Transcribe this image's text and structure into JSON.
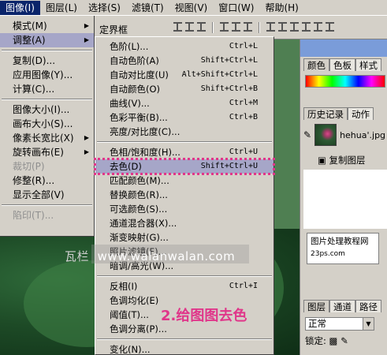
{
  "menubar": {
    "items": [
      "图像(I)",
      "图层(L)",
      "选择(S)",
      "滤镜(T)",
      "视图(V)",
      "窗口(W)",
      "帮助(H)"
    ],
    "active_index": 0
  },
  "options_bar": {
    "label": "定界框"
  },
  "image_menu": {
    "items": [
      {
        "label": "模式(M)",
        "submenu": true
      },
      {
        "label": "调整(A)",
        "submenu": true,
        "highlighted": true
      },
      {
        "sep": true
      },
      {
        "label": "复制(D)..."
      },
      {
        "label": "应用图像(Y)..."
      },
      {
        "label": "计算(C)..."
      },
      {
        "sep": true
      },
      {
        "label": "图像大小(I)..."
      },
      {
        "label": "画布大小(S)..."
      },
      {
        "label": "像素长宽比(X)",
        "submenu": true
      },
      {
        "label": "旋转画布(E)",
        "submenu": true
      },
      {
        "label": "裁切(P)",
        "disabled": true
      },
      {
        "label": "修整(R)..."
      },
      {
        "label": "显示全部(V)"
      },
      {
        "sep": true
      },
      {
        "label": "陷印(T)...",
        "disabled": true
      }
    ]
  },
  "adjust_menu": {
    "items": [
      {
        "label": "色阶(L)...",
        "shortcut": "Ctrl+L"
      },
      {
        "label": "自动色阶(A)",
        "shortcut": "Shift+Ctrl+L"
      },
      {
        "label": "自动对比度(U)",
        "shortcut": "Alt+Shift+Ctrl+L"
      },
      {
        "label": "自动颜色(O)",
        "shortcut": "Shift+Ctrl+B"
      },
      {
        "label": "曲线(V)...",
        "shortcut": "Ctrl+M"
      },
      {
        "label": "色彩平衡(B)...",
        "shortcut": "Ctrl+B"
      },
      {
        "label": "亮度/对比度(C)...",
        "shortcut": ""
      },
      {
        "sep": true
      },
      {
        "label": "色相/饱和度(H)...",
        "shortcut": "Ctrl+U"
      },
      {
        "label": "去色(D)",
        "shortcut": "Shift+Ctrl+U",
        "highlighted": true
      },
      {
        "label": "匹配颜色(M)...",
        "shortcut": ""
      },
      {
        "label": "替换颜色(R)...",
        "shortcut": ""
      },
      {
        "label": "可选颜色(S)...",
        "shortcut": ""
      },
      {
        "label": "通道混合器(X)...",
        "shortcut": ""
      },
      {
        "label": "渐变映射(G)...",
        "shortcut": ""
      },
      {
        "label": "照片滤镜(F)...",
        "shortcut": ""
      },
      {
        "label": "暗调/高光(W)...",
        "shortcut": ""
      },
      {
        "sep": true
      },
      {
        "label": "反相(I)",
        "shortcut": "Ctrl+I"
      },
      {
        "label": "色调均化(E)",
        "shortcut": ""
      },
      {
        "label": "阈值(T)...",
        "shortcut": ""
      },
      {
        "label": "色调分离(P)...",
        "shortcut": ""
      },
      {
        "sep": true
      },
      {
        "label": "变化(N)...",
        "shortcut": ""
      }
    ]
  },
  "panels": {
    "color_tabs": [
      "颜色",
      "色板",
      "样式"
    ],
    "history_tabs": [
      "历史记录",
      "动作"
    ],
    "history_file": "hehua'.jpg",
    "history_action": "复制图层",
    "watermark_line1": "图片处理",
    "watermark_line1b": "教程网",
    "watermark_line2": "23ps.com",
    "layers_tabs": [
      "图层",
      "通道",
      "路径"
    ],
    "blend_mode": "正常",
    "lock_label": "锁定:"
  },
  "overlay": {
    "site_prefix": "瓦栏",
    "site_url": "www.walanwalan.com",
    "annotation": "2.给图图去色"
  },
  "colors": {
    "highlight": "#a6a6c8",
    "annotation": "#e0368a",
    "menubar_active": "#0a246a"
  }
}
